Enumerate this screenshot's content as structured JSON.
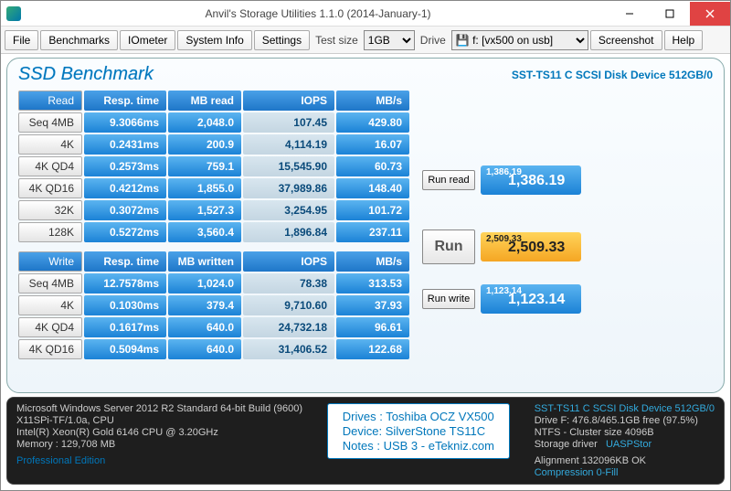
{
  "window": {
    "title": "Anvil's Storage Utilities 1.1.0 (2014-January-1)"
  },
  "menu": {
    "file": "File",
    "benchmarks": "Benchmarks",
    "iometer": "IOmeter",
    "sysinfo": "System Info",
    "settings": "Settings",
    "testsize_label": "Test size",
    "testsize_value": "1GB",
    "drive_label": "Drive",
    "drive_value": "f: [vx500 on usb]",
    "screenshot": "Screenshot",
    "help": "Help"
  },
  "bench": {
    "title": "SSD Benchmark",
    "device": "SST-TS11 C SCSI Disk Device 512GB/0",
    "read_header": {
      "row": "Read",
      "resp": "Resp. time",
      "mb": "MB read",
      "iops": "IOPS",
      "mbs": "MB/s"
    },
    "write_header": {
      "row": "Write",
      "resp": "Resp. time",
      "mb": "MB written",
      "iops": "IOPS",
      "mbs": "MB/s"
    },
    "read": [
      {
        "name": "Seq 4MB",
        "resp": "9.3066ms",
        "mb": "2,048.0",
        "iops": "107.45",
        "mbs": "429.80"
      },
      {
        "name": "4K",
        "resp": "0.2431ms",
        "mb": "200.9",
        "iops": "4,114.19",
        "mbs": "16.07"
      },
      {
        "name": "4K QD4",
        "resp": "0.2573ms",
        "mb": "759.1",
        "iops": "15,545.90",
        "mbs": "60.73"
      },
      {
        "name": "4K QD16",
        "resp": "0.4212ms",
        "mb": "1,855.0",
        "iops": "37,989.86",
        "mbs": "148.40"
      },
      {
        "name": "32K",
        "resp": "0.3072ms",
        "mb": "1,527.3",
        "iops": "3,254.95",
        "mbs": "101.72"
      },
      {
        "name": "128K",
        "resp": "0.5272ms",
        "mb": "3,560.4",
        "iops": "1,896.84",
        "mbs": "237.11"
      }
    ],
    "write": [
      {
        "name": "Seq 4MB",
        "resp": "12.7578ms",
        "mb": "1,024.0",
        "iops": "78.38",
        "mbs": "313.53"
      },
      {
        "name": "4K",
        "resp": "0.1030ms",
        "mb": "379.4",
        "iops": "9,710.60",
        "mbs": "37.93"
      },
      {
        "name": "4K QD4",
        "resp": "0.1617ms",
        "mb": "640.0",
        "iops": "24,732.18",
        "mbs": "96.61"
      },
      {
        "name": "4K QD16",
        "resp": "0.5094ms",
        "mb": "640.0",
        "iops": "31,406.52",
        "mbs": "122.68"
      }
    ],
    "runread": "Run read",
    "runwrite": "Run write",
    "run": "Run",
    "score_read": {
      "small": "1,386.19",
      "big": "1,386.19"
    },
    "score_write": {
      "small": "1,123.14",
      "big": "1,123.14"
    },
    "score_total": {
      "small": "2,509.33",
      "big": "2,509.33"
    }
  },
  "footer": {
    "os": "Microsoft Windows Server 2012 R2 Standard 64-bit Build (9600)",
    "mb": "X11SPi-TF/1.0a, CPU",
    "cpu": "Intel(R) Xeon(R) Gold 6146 CPU @ 3.20GHz",
    "mem": "Memory : 129,708 MB",
    "pro": "Professional Edition",
    "notes1": "Drives : Toshiba OCZ VX500",
    "notes2": "Device: SilverStone TS11C",
    "notes3": "Notes : USB 3 - eTekniz.com",
    "dev": "SST-TS11 C SCSI Disk Device 512GB/0",
    "drv": "Drive F: 476.8/465.1GB free (97.5%)",
    "fs": "NTFS - Cluster size 4096B",
    "sd_label": "Storage driver",
    "sd_value": "UASPStor",
    "align": "Alignment 132096KB OK",
    "comp": "Compression 0-Fill"
  }
}
